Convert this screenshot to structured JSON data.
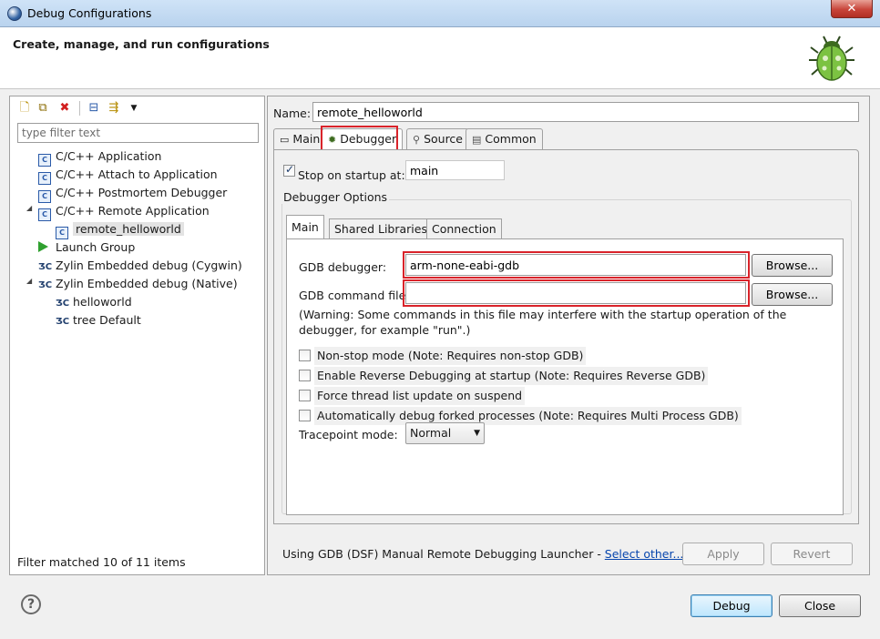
{
  "window": {
    "title": "Debug Configurations",
    "close_symbol": "✕",
    "accent": "#d9232a"
  },
  "header": {
    "title": "Create, manage, and run configurations",
    "icon": "bug-icon"
  },
  "left": {
    "toolbar_icons": [
      "new-configuration-icon",
      "duplicate-icon",
      "delete-icon",
      "collapse-all-icon",
      "filter-icon",
      "dropdown-arrow-icon"
    ],
    "filter_placeholder": "type filter text",
    "tree": [
      {
        "label": "C/C++ Application",
        "icon": "c-app-icon"
      },
      {
        "label": "C/C++ Attach to Application",
        "icon": "c-app-icon"
      },
      {
        "label": "C/C++ Postmortem Debugger",
        "icon": "c-app-icon"
      },
      {
        "label": "C/C++ Remote Application",
        "icon": "c-app-icon",
        "expanded": true
      },
      {
        "label": "remote_helloworld",
        "icon": "c-app-icon",
        "selected": true
      },
      {
        "label": "Launch Group",
        "icon": "launch-group-icon"
      },
      {
        "label": "Zylin Embedded debug (Cygwin)",
        "icon": "zylin-icon"
      },
      {
        "label": "Zylin Embedded debug (Native)",
        "icon": "zylin-icon",
        "expanded": true
      },
      {
        "label": "helloworld",
        "icon": "zylin-icon"
      },
      {
        "label": "tree Default",
        "icon": "zylin-icon"
      }
    ],
    "filter_status": "Filter matched 10 of 11 items"
  },
  "right": {
    "name_label": "Name:",
    "name_value": "remote_helloworld",
    "tabs": [
      {
        "label": "Main",
        "icon": "main-tab-icon"
      },
      {
        "label": "Debugger",
        "icon": "debugger-tab-icon",
        "active": true
      },
      {
        "label": "Source",
        "icon": "source-tab-icon"
      },
      {
        "label": "Common",
        "icon": "common-tab-icon"
      }
    ],
    "stop_on_startup": {
      "label": "Stop on startup at:",
      "checked": true,
      "value": "main"
    },
    "group_title": "Debugger Options",
    "inner_tabs": [
      {
        "label": "Main",
        "active": true
      },
      {
        "label": "Shared Libraries"
      },
      {
        "label": "Connection"
      }
    ],
    "gdb_debugger": {
      "label": "GDB debugger:",
      "value": "arm-none-eabi-gdb",
      "button": "Browse..."
    },
    "gdb_command_file": {
      "label": "GDB command file:",
      "value": "",
      "button": "Browse..."
    },
    "warning": "(Warning: Some commands in this file may interfere with the startup operation of the debugger, for example \"run\".)",
    "options": [
      {
        "label": "Non-stop mode (Note: Requires non-stop GDB)",
        "checked": false
      },
      {
        "label": "Enable Reverse Debugging at startup (Note: Requires Reverse GDB)",
        "checked": false
      },
      {
        "label": "Force thread list update on suspend",
        "checked": false
      },
      {
        "label": "Automatically debug forked processes (Note: Requires Multi Process GDB)",
        "checked": false
      }
    ],
    "tracepoint": {
      "label": "Tracepoint mode:",
      "value": "Normal"
    },
    "launcher_text": "Using GDB (DSF) Manual Remote Debugging Launcher - ",
    "select_other": "Select other...",
    "apply": "Apply",
    "revert": "Revert"
  },
  "footer": {
    "help_symbol": "?",
    "debug": "Debug",
    "close": "Close"
  }
}
